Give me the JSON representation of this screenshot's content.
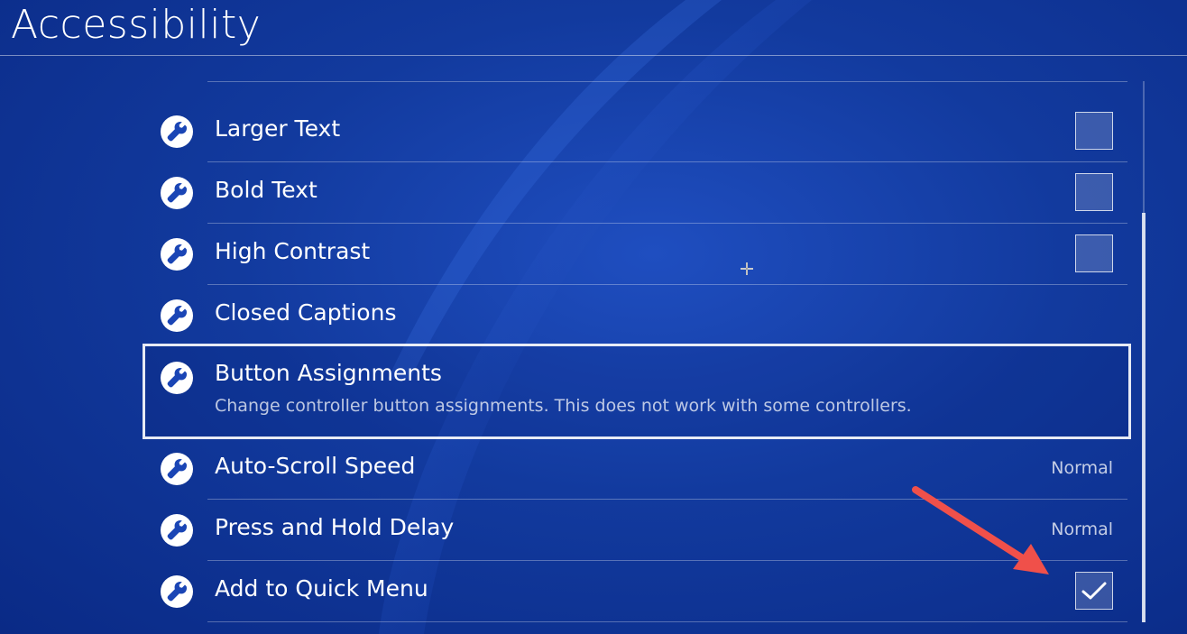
{
  "header": {
    "title": "Accessibility"
  },
  "settings": [
    {
      "label": "Larger Text",
      "control": "checkbox",
      "checked": false,
      "icon": "wrench-icon"
    },
    {
      "label": "Bold Text",
      "control": "checkbox",
      "checked": false,
      "icon": "wrench-icon"
    },
    {
      "label": "High Contrast",
      "control": "checkbox",
      "checked": false,
      "icon": "wrench-icon"
    },
    {
      "label": "Closed Captions",
      "control": "none",
      "icon": "wrench-icon"
    },
    {
      "label": "Button Assignments",
      "description": "Change controller button assignments. This does not work with some controllers.",
      "control": "none",
      "selected": true,
      "icon": "wrench-icon"
    },
    {
      "label": "Auto-Scroll Speed",
      "control": "value",
      "value": "Normal",
      "icon": "wrench-icon"
    },
    {
      "label": "Press and Hold Delay",
      "control": "value",
      "value": "Normal",
      "icon": "wrench-icon"
    },
    {
      "label": "Add to Quick Menu",
      "control": "checkbox",
      "checked": true,
      "icon": "wrench-icon"
    }
  ],
  "colors": {
    "background": "#123a9e",
    "annotation_arrow": "#f0504a"
  }
}
